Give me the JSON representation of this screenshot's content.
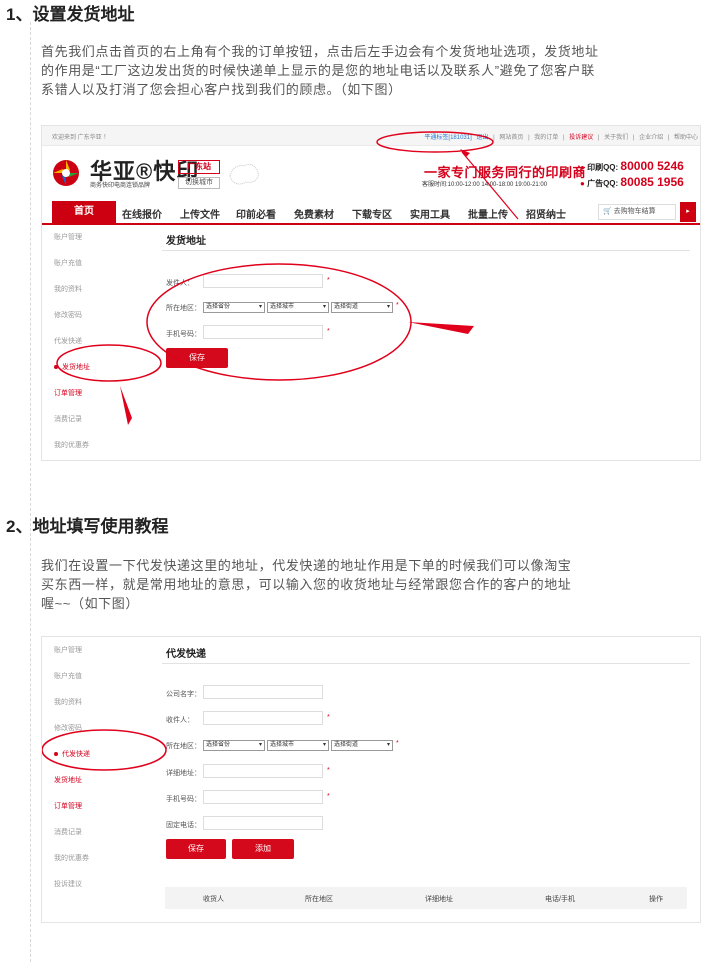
{
  "section1": {
    "title": "1、设置发货地址",
    "paragraph": [
      "首先我们点击首页的右上角有个我的订单按钮，点击后左手边会有个发货地址选项，发货地址",
      "的作用是“工厂这边发出货的时候快递单上显示的是您的地址电话以及联系人”避免了您客户联",
      "系错人以及打消了您会担心客户找到我们的顾虑。（如下图）"
    ]
  },
  "section2": {
    "title": "2、地址填写使用教程",
    "paragraph": [
      "我们在设置一下代发快递这里的地址，代发快递的地址作用是下单的时候我们可以像淘宝",
      "买东西一样，就是常用地址的意思，可以输入您的收货地址与经常跟您合作的客户的地址",
      "喔~~（如下图）"
    ]
  },
  "shot1": {
    "topbar": {
      "welcome": "欢迎来到 广东华亚 ！",
      "links": [
        "平通标签[181031]",
        "退出",
        "|",
        "网站首页",
        "|",
        "我的订单",
        "|",
        "投诉建议",
        "|",
        "关于我们",
        "|",
        "企业介绍",
        "|",
        "帮助中心"
      ]
    },
    "brand": {
      "name": "华亚®快印",
      "sub": "商务快印电商连锁品牌",
      "site": "广东站",
      "switch_city": "切换城市"
    },
    "slogan": "一家专门服务同行的印刷商",
    "hours": "客服时间:10:00-12:00  14:00-18:00  19:00-21:00",
    "qq": [
      {
        "label": "印刷QQ:",
        "number": "80000 5246"
      },
      {
        "label": "广告QQ:",
        "number": "80085 1956"
      }
    ],
    "nav": {
      "home": "首页",
      "items": [
        "在线报价",
        "上传文件",
        "印前必看",
        "免费素材",
        "下载专区",
        "实用工具",
        "批量上传",
        "招贤纳士"
      ],
      "cart": "去购物车结算",
      "arrow": "▸"
    },
    "sidebar": [
      "账户管理",
      "账户充值",
      "我的资料",
      "修改密码",
      "代发快递",
      "发货地址",
      "订单管理",
      "消费记录",
      "我的优惠券"
    ],
    "panel_title": "发货地址",
    "form": {
      "sender_label": "发件人：",
      "region_label": "所在地区：",
      "province": "选择省份",
      "city": "选择城市",
      "street": "选择街道",
      "phone_label": "手机号码：",
      "required": "*",
      "save": "保存"
    }
  },
  "shot2": {
    "sidebar": [
      "账户管理",
      "账户充值",
      "我的资料",
      "修改密码",
      "代发快递",
      "发货地址",
      "订单管理",
      "消费记录",
      "我的优惠券",
      "投诉建议"
    ],
    "panel_title": "代发快递",
    "form": {
      "company_label": "公司名字：",
      "recipient_label": "收件人：",
      "region_label": "所在地区：",
      "province": "选择省份",
      "city": "选择城市",
      "street": "选择街道",
      "address_label": "详细地址：",
      "phone_label": "手机号码：",
      "landline_label": "固定电话：",
      "required": "*",
      "save": "保存",
      "add": "添加"
    },
    "table_headers": [
      "收货人",
      "所在地区",
      "详细地址",
      "电话/手机",
      "操作"
    ]
  },
  "colors": {
    "accent_red": "#cc0011",
    "link_blue": "#2a7ad2",
    "text_gray": "#555555"
  }
}
